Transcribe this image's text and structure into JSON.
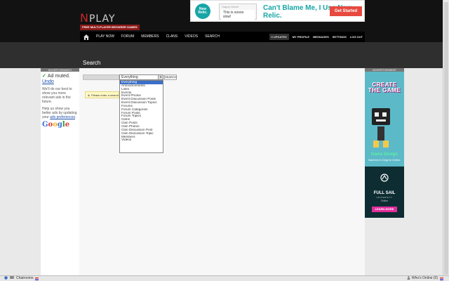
{
  "site": {
    "logo_n": "N",
    "logo_rest": "PLAY",
    "tagline": "FREE MULTI-PLAYER BROWSER GAMES"
  },
  "top_ad": {
    "logo_text": "New Relic.",
    "chat_head": "Happy Owner",
    "chat_msg": "This is soooo slow!",
    "headline": "Can't Blame Me, I Use New Relic.",
    "cta": "Get Started"
  },
  "nav": {
    "items": [
      "PLAY NOW",
      "FORUM",
      "MEMBERS",
      "CLANS",
      "VIDEOS",
      "SEARCH"
    ],
    "updates": "0 UPDATES",
    "right_items": [
      "MY PROFILE",
      "MESSAGES",
      "SETTINGS",
      "LOG OUT"
    ]
  },
  "page": {
    "title": "Search"
  },
  "search": {
    "input_value": "",
    "selected": "Everything",
    "button": "SEARCH",
    "notice": "Please enter a search",
    "options": [
      "Everything",
      "Announcements",
      "Links",
      "Events",
      "Event Photos",
      "Event Discussion Posts",
      "Event Discussion Topics",
      "Forums",
      "Forum Categories",
      "Forum Posts",
      "Forum Topics",
      "Clans",
      "Clan Posts",
      "Clan Photos",
      "Clan Discussion Post",
      "Clan Discussion Topic",
      "Members",
      "Videos"
    ]
  },
  "left_ad": {
    "label": "ADVERTISEMENT",
    "muted": "Ad muted.",
    "undo": "Undo",
    "text1": "We'll do our best to show you more relevant ads in the future.",
    "text2": "Help us show you better ads by updating your",
    "pref_link": "ads preferences",
    "period": ".",
    "google": "Google"
  },
  "right_ad": {
    "label": "ADVERTISEMENT",
    "title": "CREATE THE GAME",
    "heading": "Game Design",
    "sub": "Bachelor's Degree Online",
    "brand": "FULL SAIL",
    "university": "UNIVERSITY",
    "online": "Online",
    "cta": "LEARN MORE"
  },
  "footer": {
    "chatrooms": "Chatrooms",
    "whos_online": "Who's Online (0)"
  },
  "colors": {
    "accent_red": "#8b1a1a",
    "selection_blue": "#3b6fc9",
    "notice_yellow": "#fff8c4",
    "nav_bg": "#000000"
  }
}
